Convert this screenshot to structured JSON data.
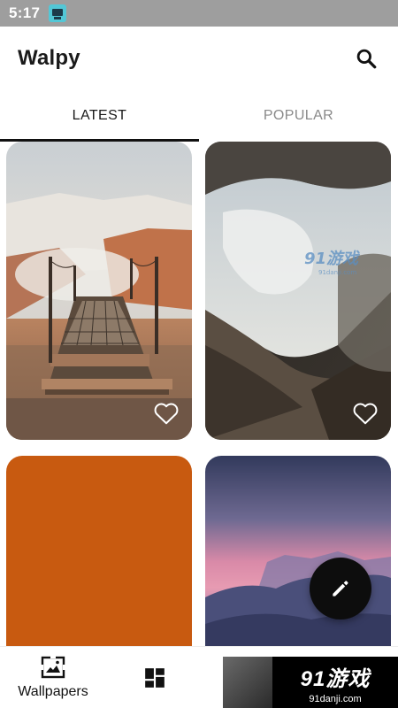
{
  "status_bar": {
    "time": "5:17",
    "app_icon": "notification-app-icon"
  },
  "app_bar": {
    "title": "Walpy",
    "search_icon": "search-icon"
  },
  "tabs": [
    {
      "label": "LATEST",
      "active": true
    },
    {
      "label": "POPULAR",
      "active": false
    }
  ],
  "wallpapers": [
    {
      "subject": "wooden boardwalk over misty geothermal field",
      "favorite_icon": "heart-outline-icon"
    },
    {
      "subject": "ice cave opening with rocky slopes",
      "favorite_icon": "heart-outline-icon",
      "overlay_text": "91游戏",
      "overlay_url": "91danji.com"
    },
    {
      "subject": "solid orange",
      "color": "#C85A10"
    },
    {
      "subject": "purple mountain sunset"
    }
  ],
  "fab": {
    "icon": "pencil-icon"
  },
  "bottom_nav": [
    {
      "label": "Wallpapers",
      "icon": "wallpapers-icon"
    },
    {
      "label": "",
      "icon": "dashboard-icon"
    }
  ],
  "watermark": {
    "mark": "91游戏",
    "url": "91danji.com"
  },
  "colors": {
    "accent": "#111111",
    "tab_inactive": "#8a8a8a",
    "status_bar": "#9e9e9e",
    "orange_card": "#C85A10"
  }
}
